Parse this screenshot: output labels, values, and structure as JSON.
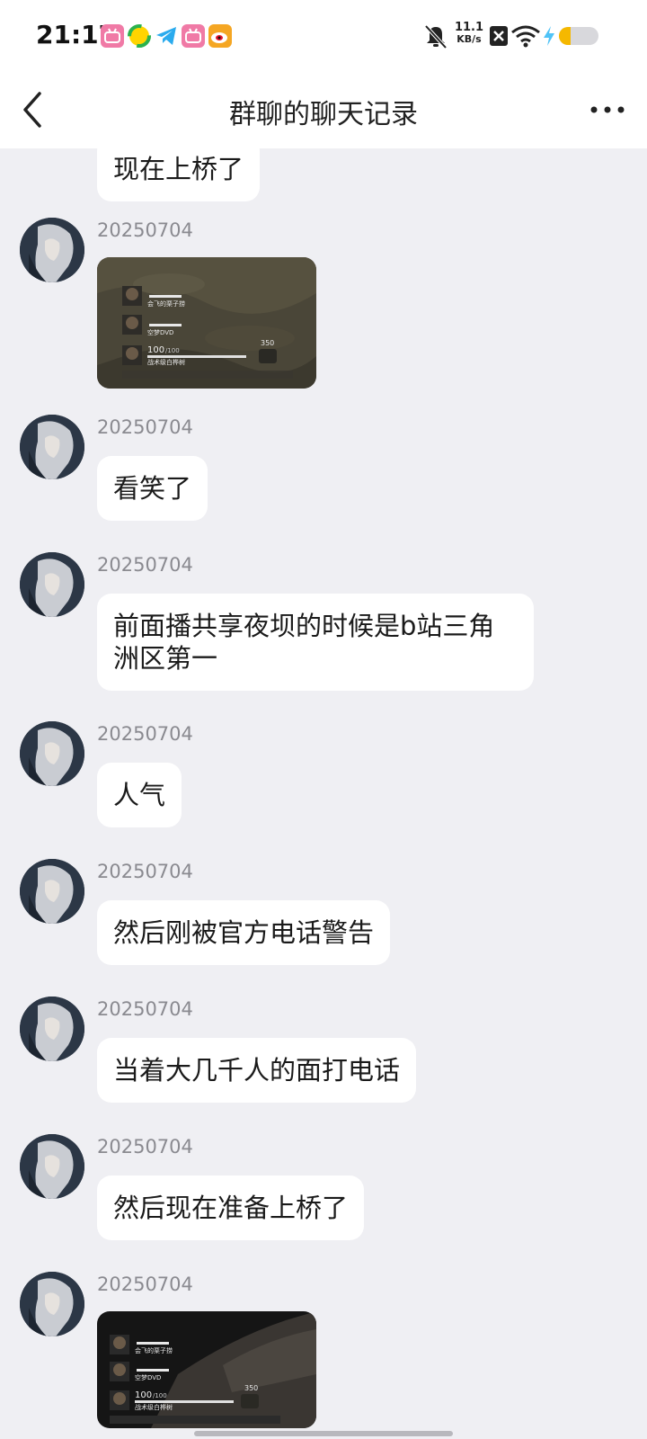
{
  "status_bar": {
    "time": "21:17",
    "net_speed_value": "11.1",
    "net_speed_unit": "KB/s",
    "notification_icons": [
      "bilibili-icon",
      "green-app-icon",
      "telegram-icon",
      "bilibili-icon",
      "weibo-icon"
    ]
  },
  "header": {
    "title": "群聊的聊天记录"
  },
  "messages": [
    {
      "date": "",
      "text": "现在上桥了",
      "type": "text"
    },
    {
      "date": "20250704",
      "type": "image"
    },
    {
      "date": "20250704",
      "text": "看笑了",
      "type": "text"
    },
    {
      "date": "20250704",
      "text": "前面播共享夜坝的时候是b站三角洲区第一",
      "type": "text"
    },
    {
      "date": "20250704",
      "text": "人气",
      "type": "text"
    },
    {
      "date": "20250704",
      "text": "然后刚被官方电话警告",
      "type": "text"
    },
    {
      "date": "20250704",
      "text": "当着大几千人的面打电话",
      "type": "text"
    },
    {
      "date": "20250704",
      "text": "然后现在准备上桥了",
      "type": "text"
    },
    {
      "date": "20250704",
      "type": "image"
    }
  ],
  "game_hud": {
    "names": [
      "会飞的栗子捞",
      "空梦DVD",
      "战术级白桦树"
    ],
    "health": "100",
    "health_max": "/100",
    "ammo": "350"
  },
  "colors": {
    "background": "#efeff3",
    "bubble": "#ffffff",
    "date_text": "#8a8a90",
    "bilibili": "#f07aa6",
    "telegram": "#2aabee",
    "weibo": "#f5a623"
  }
}
